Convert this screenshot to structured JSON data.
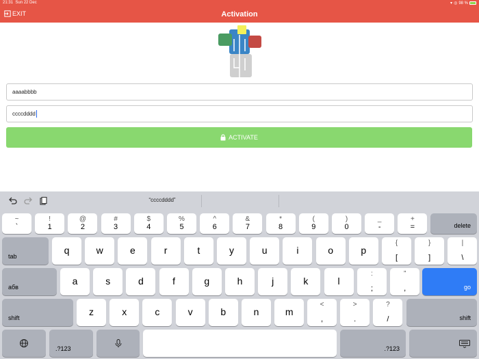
{
  "statusbar": {
    "time": "21:31",
    "date": "Sun 22 Dec",
    "battery": "98 %"
  },
  "header": {
    "exit_label": "EXIT",
    "title": "Activation"
  },
  "form": {
    "field1_value": "aaaabbbb",
    "field2_value": "ccccdddd",
    "activate_label": "ACTIVATE"
  },
  "keyboard": {
    "suggestion": "“ccccdddd”",
    "row1": [
      {
        "top": "~",
        "bottom": "`"
      },
      {
        "top": "!",
        "bottom": "1"
      },
      {
        "top": "@",
        "bottom": "2"
      },
      {
        "top": "#",
        "bottom": "3"
      },
      {
        "top": "$",
        "bottom": "4"
      },
      {
        "top": "%",
        "bottom": "5"
      },
      {
        "top": "^",
        "bottom": "6"
      },
      {
        "top": "&",
        "bottom": "7"
      },
      {
        "top": "*",
        "bottom": "8"
      },
      {
        "top": "(",
        "bottom": "9"
      },
      {
        "top": ")",
        "bottom": "0"
      },
      {
        "top": "_",
        "bottom": "-"
      },
      {
        "top": "+",
        "bottom": "="
      }
    ],
    "row2": [
      "q",
      "w",
      "e",
      "r",
      "t",
      "y",
      "u",
      "i",
      "o",
      "p"
    ],
    "row2_extra": [
      {
        "top": "{",
        "bottom": "["
      },
      {
        "top": "}",
        "bottom": "]"
      },
      {
        "top": "|",
        "bottom": "\\"
      }
    ],
    "row3": [
      "a",
      "s",
      "d",
      "f",
      "g",
      "h",
      "j",
      "k",
      "l"
    ],
    "row3_extra": [
      {
        "top": ":",
        "bottom": ";"
      },
      {
        "top": "”",
        "bottom": ","
      }
    ],
    "row4": [
      "z",
      "x",
      "c",
      "v",
      "b",
      "n",
      "m"
    ],
    "row4_extra": [
      {
        "top": "<",
        "bottom": ","
      },
      {
        "top": ">",
        "bottom": "."
      },
      {
        "top": "?",
        "bottom": "/"
      }
    ],
    "delete_label": "delete",
    "tab_label": "tab",
    "abc_label": "абв",
    "go_label": "go",
    "shift_label": "shift",
    "numeric_label": ".?123"
  },
  "colors": {
    "header": "#e65546",
    "activate": "#89d86f",
    "go_key": "#2f7cf6",
    "keyboard_bg": "#d1d3d9"
  }
}
